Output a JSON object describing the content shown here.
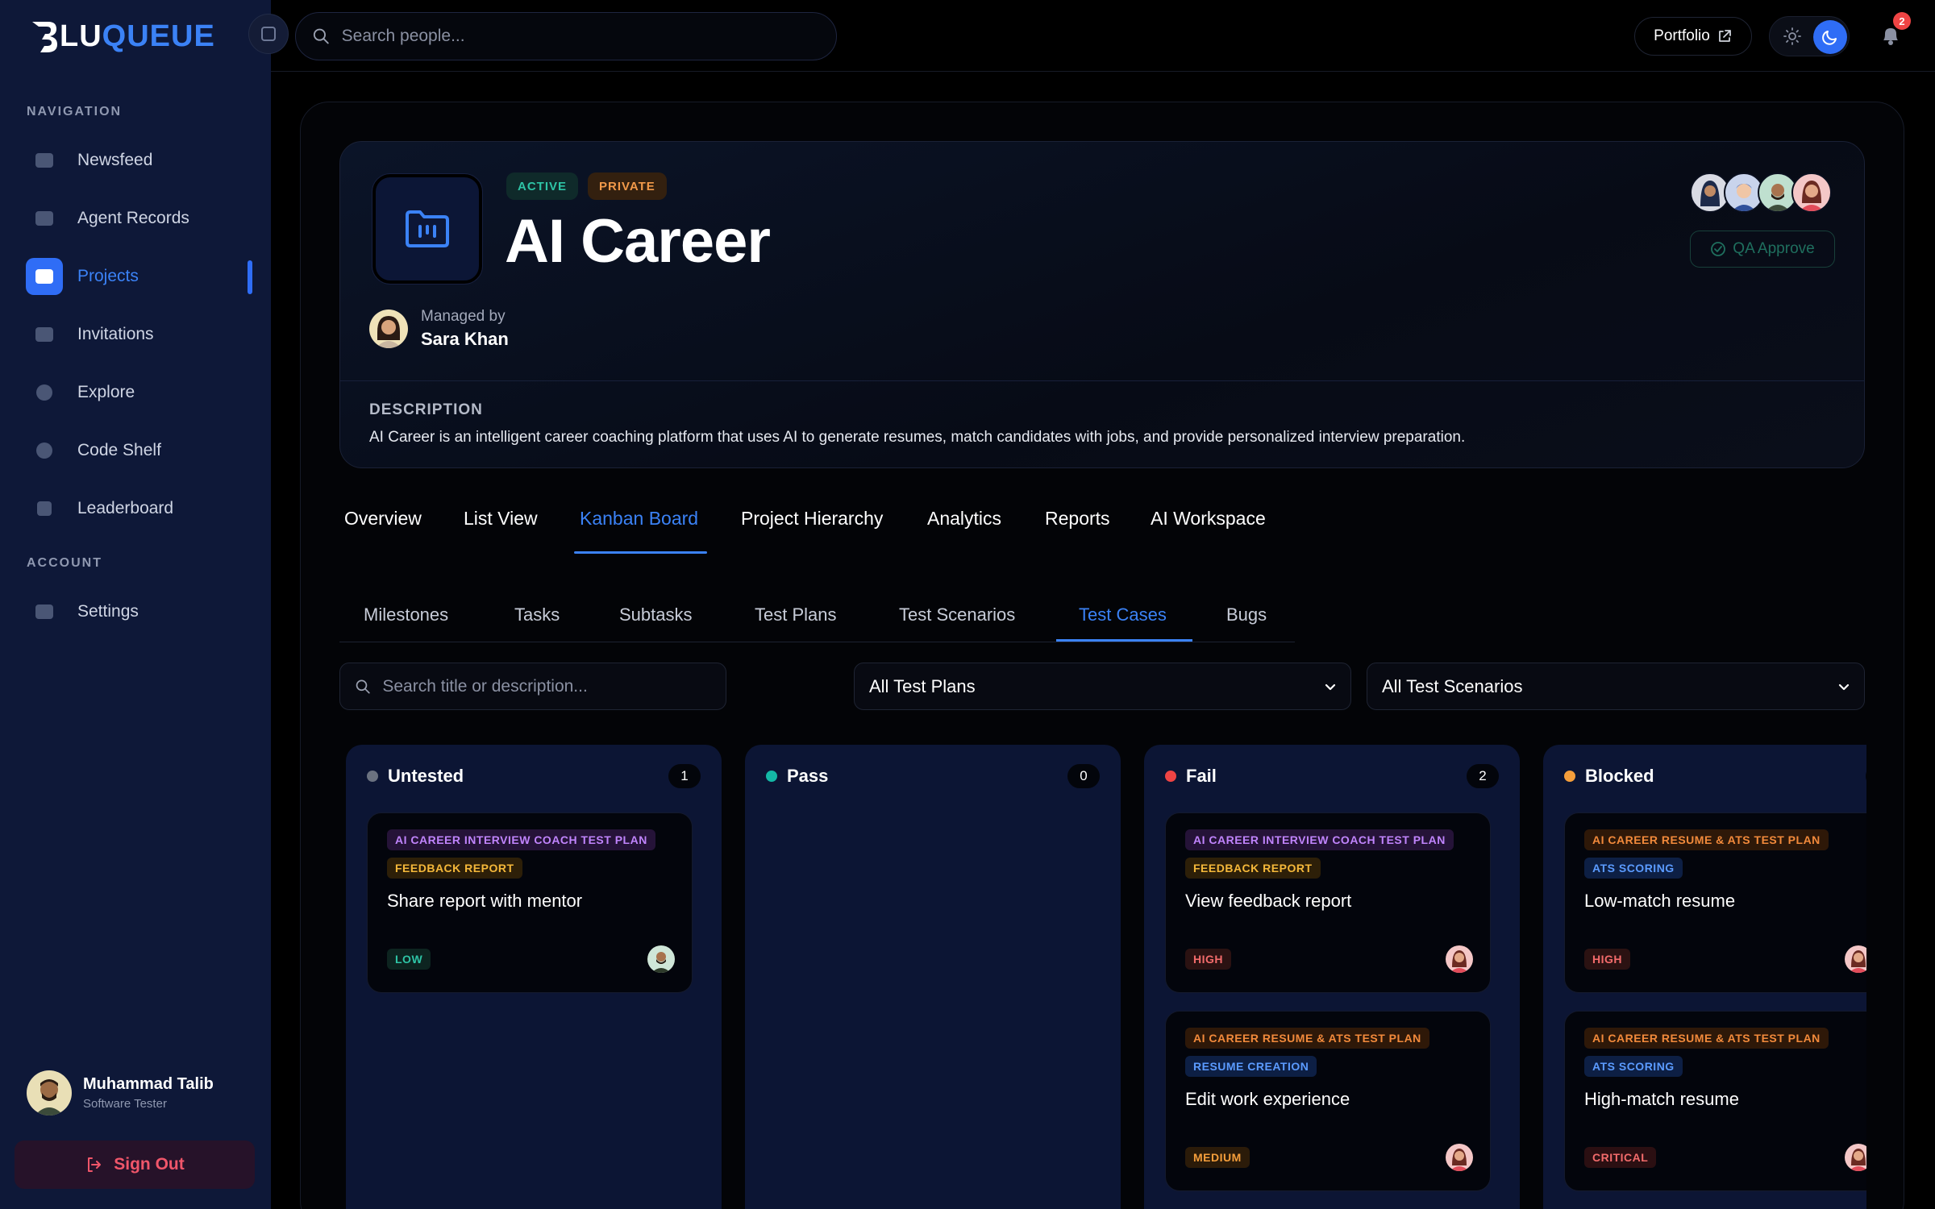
{
  "app": {
    "logo_b": "B",
    "logo_lu": "LU",
    "logo_queue": "QUEUE"
  },
  "sidebar": {
    "nav_label": "NAVIGATION",
    "account_label": "ACCOUNT",
    "items": [
      {
        "label": "Newsfeed",
        "icon": "newsfeed-icon"
      },
      {
        "label": "Agent Records",
        "icon": "monitor-icon"
      },
      {
        "label": "Projects",
        "icon": "folder-icon"
      },
      {
        "label": "Invitations",
        "icon": "mail-icon"
      },
      {
        "label": "Explore",
        "icon": "search-icon"
      },
      {
        "label": "Code Shelf",
        "icon": "code-icon"
      },
      {
        "label": "Leaderboard",
        "icon": "chart-icon"
      }
    ],
    "settings_label": "Settings",
    "user": {
      "name": "Muhammad Talib",
      "role": "Software Tester"
    },
    "signout_label": "Sign Out"
  },
  "topbar": {
    "search_placeholder": "Search people...",
    "portfolio_label": "Portfolio",
    "notification_count": "2"
  },
  "project": {
    "status": "ACTIVE",
    "visibility": "PRIVATE",
    "title": "AI Career",
    "managed_by_label": "Managed by",
    "manager": "Sara Khan",
    "qa_label": "QA Approve",
    "description_label": "DESCRIPTION",
    "description": "AI Career is an intelligent career coaching platform that uses AI to generate resumes, match candidates with jobs, and provide personalized interview preparation."
  },
  "tabs": [
    "Overview",
    "List View",
    "Kanban Board",
    "Project Hierarchy",
    "Analytics",
    "Reports",
    "AI Workspace"
  ],
  "active_tab": "Kanban Board",
  "subtabs": [
    "Milestones",
    "Tasks",
    "Subtasks",
    "Test Plans",
    "Test Scenarios",
    "Test Cases",
    "Bugs"
  ],
  "active_subtab": "Test Cases",
  "filters": {
    "search_placeholder": "Search title or description...",
    "test_plans": "All Test Plans",
    "test_scenarios": "All Test Scenarios"
  },
  "columns": [
    {
      "title": "Untested",
      "count": "1",
      "color": "#6b7280",
      "cards": [
        {
          "plan": "AI CAREER INTERVIEW COACH TEST PLAN",
          "scenario": "FEEDBACK REPORT",
          "title": "Share report with mentor",
          "priority": "LOW"
        }
      ]
    },
    {
      "title": "Pass",
      "count": "0",
      "color": "#14b8a6",
      "cards": []
    },
    {
      "title": "Fail",
      "count": "2",
      "color": "#ef4444",
      "cards": [
        {
          "plan": "AI CAREER INTERVIEW COACH TEST PLAN",
          "scenario": "FEEDBACK REPORT",
          "title": "View feedback report",
          "priority": "HIGH"
        },
        {
          "plan": "AI CAREER RESUME & ATS TEST PLAN",
          "scenario": "RESUME CREATION",
          "title": "Edit work experience",
          "priority": "MEDIUM"
        }
      ]
    },
    {
      "title": "Blocked",
      "count": "",
      "color": "#f59e3b",
      "cards": [
        {
          "plan": "AI CAREER RESUME & ATS TEST PLAN",
          "scenario": "ATS SCORING",
          "title": "Low-match resume",
          "priority": "HIGH"
        },
        {
          "plan": "AI CAREER RESUME & ATS TEST PLAN",
          "scenario": "ATS SCORING",
          "title": "High-match resume",
          "priority": "CRITICAL"
        }
      ]
    }
  ]
}
